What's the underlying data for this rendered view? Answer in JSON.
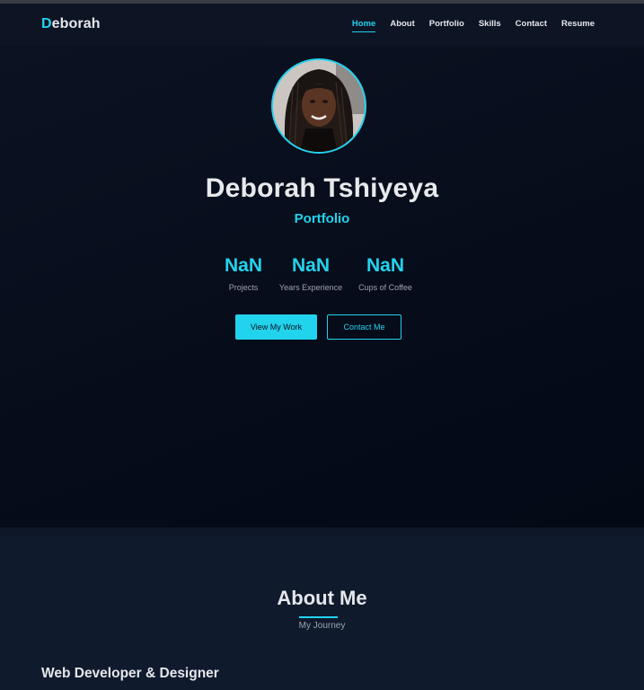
{
  "brand": {
    "logo_first_letter": "D",
    "logo_rest": "eborah",
    "accent_color": "#22d3ee"
  },
  "nav": {
    "items": [
      {
        "label": "Home",
        "active": true
      },
      {
        "label": "About"
      },
      {
        "label": "Portfolio"
      },
      {
        "label": "Skills"
      },
      {
        "label": "Contact"
      },
      {
        "label": "Resume"
      }
    ]
  },
  "hero": {
    "name": "Deborah Tshiyeya",
    "role": "Portfolio",
    "stats": [
      {
        "value": "NaN",
        "label": "Projects"
      },
      {
        "value": "NaN",
        "label": "Years Experience"
      },
      {
        "value": "NaN",
        "label": "Cups of Coffee"
      }
    ],
    "primary_button": "View My Work",
    "secondary_button": "Contact Me"
  },
  "about": {
    "title": "About Me",
    "subtitle": "My Journey",
    "heading": "Web Developer & Designer"
  }
}
